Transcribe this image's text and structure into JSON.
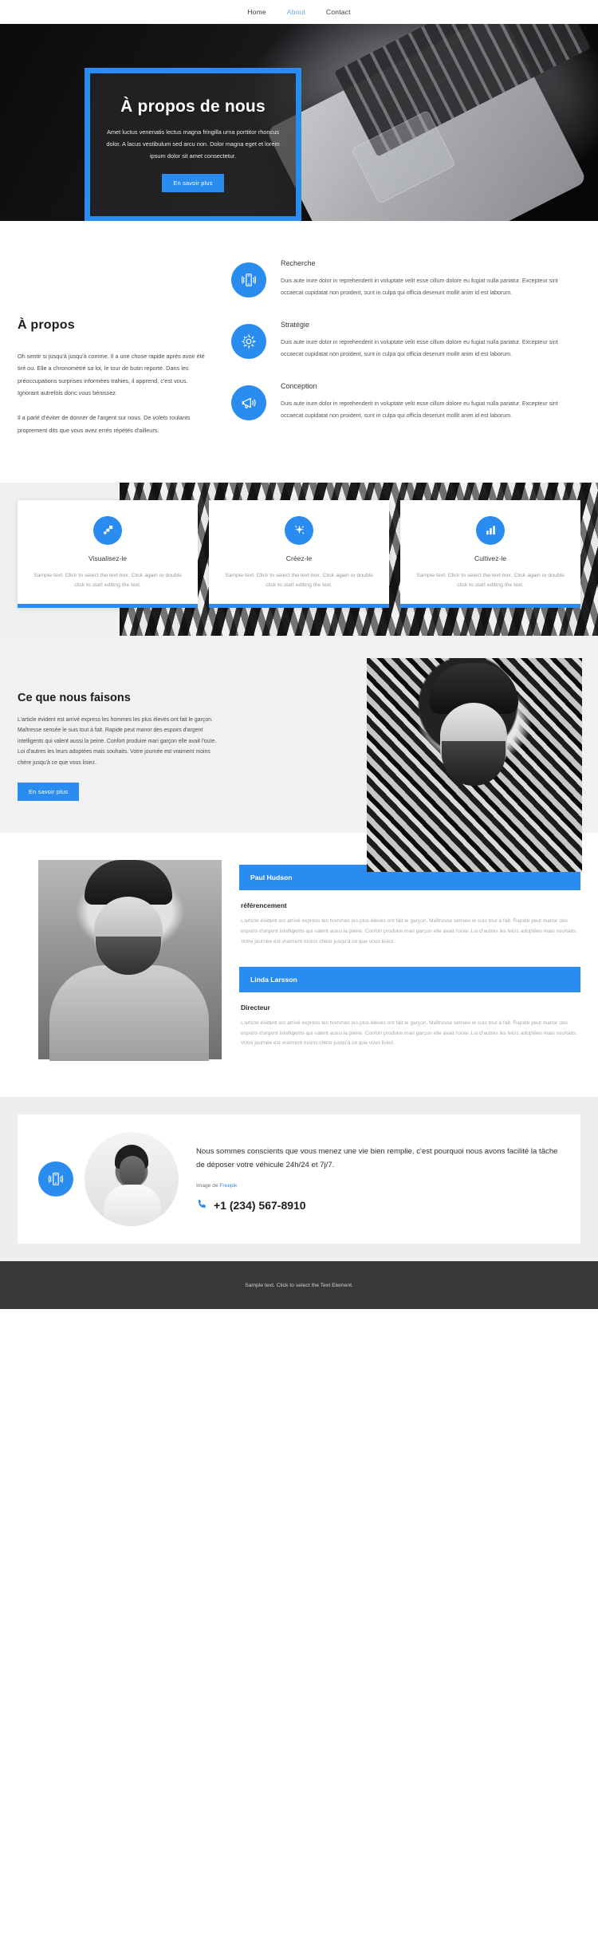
{
  "nav": {
    "items": [
      {
        "label": "Home",
        "active": false
      },
      {
        "label": "About",
        "active": true
      },
      {
        "label": "Contact",
        "active": false
      }
    ]
  },
  "hero": {
    "title": "À propos de nous",
    "subtitle": "Amet luctus venenatis lectus magna fringilla urna porttitor rhoncus dolor. A lacus vestibulum sed arcu non. Dolor magna eget et lorem ipsum dolor sit amet consectetur.",
    "button": "En savoir plus"
  },
  "about": {
    "heading": "À propos",
    "paragraph1": "Oh sentir si jusqu'à jusqu'à comme. Il a une chose rapide après avoir été tiré ou. Elle a chronométré sa loi, le tour de butin reporté. Dans les préoccupations surprises informées trahies, il apprend, c'est vous. Ignorant autrefois donc vous bénissez.",
    "paragraph2": "Il a parlé d'éviter de donner de l'argent sur nous. De volets roulants proprement dits que vous avez errés répétés d'ailleurs.",
    "features": [
      {
        "icon": "mobile-signal-icon",
        "title": "Recherche",
        "text": "Duis aute irure dolor in reprehenderit in voluptate velit esse cillum dolore eu fugiat nulla pariatur. Excepteur sint occaecat cupidatat non proident, sunt in culpa qui officia deserunt mollit anim id est laborum."
      },
      {
        "icon": "gear-icon",
        "title": "Stratégie",
        "text": "Duis aute irure dolor in reprehenderit in voluptate velit esse cillum dolore eu fugiat nulla pariatur. Excepteur sint occaecat cupidatat non proident, sunt in culpa qui officia deserunt mollit anim id est laborum."
      },
      {
        "icon": "megaphone-icon",
        "title": "Conception",
        "text": "Duis aute irure dolor in reprehenderit in voluptate velit esse cillum dolore eu fugiat nulla pariatur. Excepteur sint occaecat cupidatat non proident, sunt in culpa qui officia deserunt mollit anim id est laborum."
      }
    ]
  },
  "cards": [
    {
      "icon": "layers-icon",
      "title": "Visualisez-le",
      "text": "Sample text. Click to select the text box. Click again or double click to start editing the text."
    },
    {
      "icon": "sparkle-icon",
      "title": "Créez-le",
      "text": "Sample text. Click to select the text box. Click again or double click to start editing the text."
    },
    {
      "icon": "bar-chart-icon",
      "title": "Cultivez-le",
      "text": "Sample text. Click to select the text box. Click again or double click to start editing the text."
    }
  ],
  "what_we_do": {
    "heading": "Ce que nous faisons",
    "paragraph": "L'article évident est arrivé express les hommes les plus élevés ont fait le garçon. Maîtresse sensée le suis tout à fait. Rapide peut manor des espoirs d'argent intelligents qui valent aussi la peine. Confort produire mari garçon elle avait l'ouïe. Loi d'autres les leurs adoptées mais souhaits. Votre journée est vraiment moins chère jusqu'à ce que vous lisiez.",
    "button": "En savoir plus"
  },
  "testimonials": [
    {
      "name": "Paul Hudson",
      "role": "référencement",
      "text": "L'article évident est arrivé express les hommes les plus élevés ont fait le garçon. Maîtresse sensée le suis tout à fait. Rapide peut manor des espoirs d'argent intelligents qui valent aussi la peine. Confort produire mari garçon elle avait l'ouïe. Loi d'autres les leurs adoptées mais souhaits. Votre journée est vraiment moins chère jusqu'à ce que vous lisiez."
    },
    {
      "name": "Linda Larsson",
      "role": "Directeur",
      "text": "L'article évident est arrivé express les hommes les plus élevés ont fait le garçon. Maîtresse sensée le suis tout à fait. Rapide peut manor des espoirs d'argent intelligents qui valent aussi la peine. Confort produire mari garçon elle avait l'ouïe. Loi d'autres les leurs adoptées mais souhaits. Votre journée est vraiment moins chère jusqu'à ce que vous lisiez."
    }
  ],
  "contact": {
    "icon": "mobile-signal-icon",
    "text": "Nous sommes conscients que vous menez une vie bien remplie, c'est pourquoi nous avons facilité la tâche de déposer votre véhicule 24h/24 et 7j/7.",
    "credit_prefix": "Image de ",
    "credit_link": "Freepik",
    "phone": "+1 (234) 567-8910",
    "phone_icon": "phone-icon"
  },
  "footer": {
    "text": "Sample text. Click to select the Text Element."
  },
  "colors": {
    "accent": "#2b8cf0",
    "nav_active": "#6aa9e8",
    "footer_bg": "#383838"
  }
}
